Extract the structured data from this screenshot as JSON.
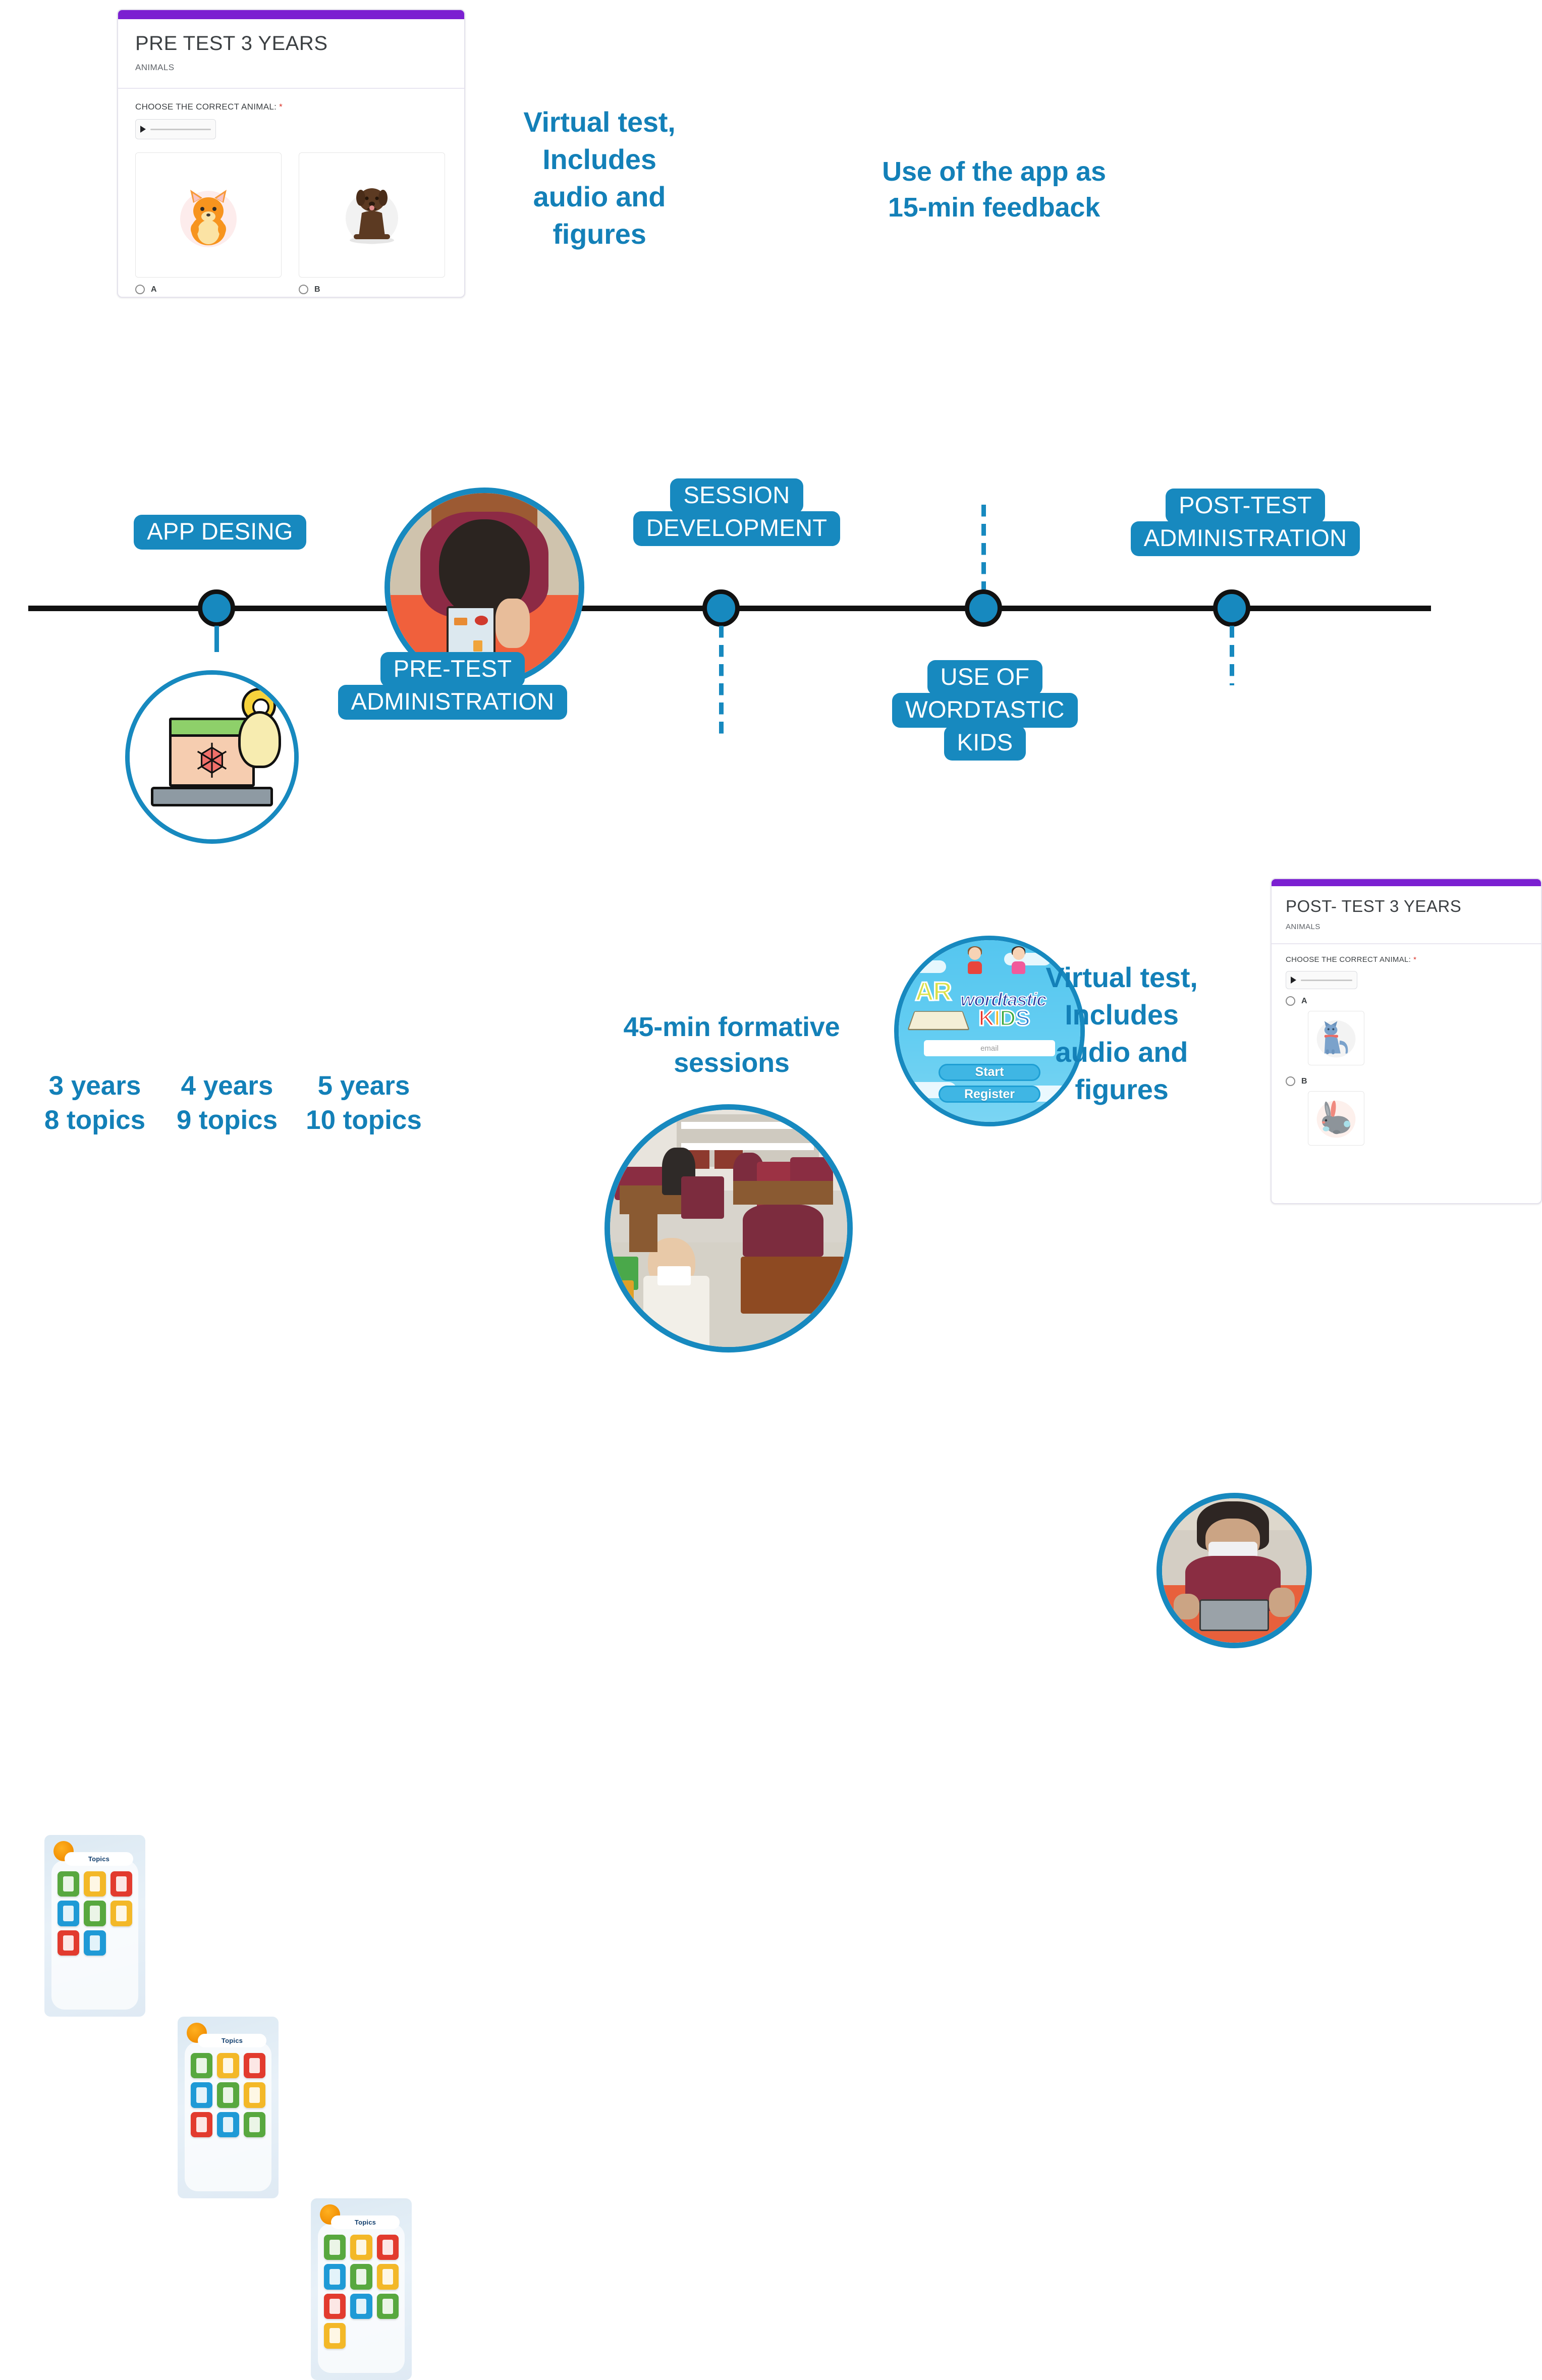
{
  "timeline": {
    "milestones": [
      {
        "id": "app-desing",
        "label_lines": [
          "APP DESING"
        ]
      },
      {
        "id": "pre-test-administration",
        "label_lines": [
          "PRE-TEST",
          "ADMINISTRATION"
        ]
      },
      {
        "id": "session-development",
        "label_lines": [
          "SESSION",
          "DEVELOPMENT"
        ]
      },
      {
        "id": "use-of-wordtastic-kids",
        "label_lines": [
          "USE OF",
          "WORDTASTIC",
          "KIDS"
        ]
      },
      {
        "id": "post-test-administration",
        "label_lines": [
          "POST-TEST",
          "ADMINISTRATION"
        ]
      }
    ],
    "accent_color": "#1789bf",
    "axis_color": "#111111"
  },
  "annotations": {
    "pre_test_note": [
      "Virtual test,",
      "Includes",
      "audio and",
      "figures"
    ],
    "app_feedback_note": [
      "Use of the app as",
      "15-min feedback"
    ],
    "sessions_note": [
      "45-min formative",
      "sessions"
    ],
    "post_test_note": [
      "Virtual test,",
      "Includes",
      "audio and",
      "figures"
    ],
    "text_color": "#1380b8"
  },
  "pre_test_form": {
    "accent_color": "#7b1fd1",
    "title": "PRE TEST 3 YEARS",
    "section": "ANIMALS",
    "question": "CHOOSE THE CORRECT ANIMAL:",
    "required_mark": "*",
    "options": [
      {
        "letter": "A",
        "image": "hamster-illustration"
      },
      {
        "letter": "B",
        "image": "dog-illustration"
      }
    ]
  },
  "post_test_form": {
    "accent_color": "#7b1fd1",
    "title": "POST- TEST 3 YEARS",
    "section": "ANIMALS",
    "question": "CHOOSE THE CORRECT ANIMAL:",
    "required_mark": "*",
    "options": [
      {
        "letter": "A",
        "image": "cat-illustration"
      },
      {
        "letter": "B",
        "image": "rabbit-illustration"
      }
    ]
  },
  "app_splash": {
    "logo_ar": "AR",
    "logo_wordtastic": "wordtastic",
    "logo_kids_letters": [
      {
        "ch": "K",
        "color": "#e8342a"
      },
      {
        "ch": "I",
        "color": "#f6b41a"
      },
      {
        "ch": "D",
        "color": "#3aa63a"
      },
      {
        "ch": "S",
        "color": "#2f7fd0"
      }
    ],
    "email_placeholder": "email",
    "start_button": "Start",
    "register_button": "Register"
  },
  "age_variants": [
    {
      "age": "3 years",
      "topics": "8 topics",
      "topics_header": "Topics",
      "tile_count": 8,
      "tile_colors": [
        "#58a83f",
        "#f3b828",
        "#e23b2e",
        "#1f9ad6",
        "#58a83f",
        "#f3b828",
        "#e23b2e",
        "#1f9ad6"
      ]
    },
    {
      "age": "4 years",
      "topics": "9 topics",
      "topics_header": "Topics",
      "tile_count": 9,
      "tile_colors": [
        "#58a83f",
        "#f3b828",
        "#e23b2e",
        "#1f9ad6",
        "#58a83f",
        "#f3b828",
        "#e23b2e",
        "#1f9ad6",
        "#58a83f"
      ]
    },
    {
      "age": "5 years",
      "topics": "10 topics",
      "topics_header": "Topics",
      "tile_count": 10,
      "tile_colors": [
        "#58a83f",
        "#f3b828",
        "#e23b2e",
        "#1f9ad6",
        "#58a83f",
        "#f3b828",
        "#e23b2e",
        "#1f9ad6",
        "#58a83f",
        "#f3b828"
      ]
    }
  ],
  "photos": [
    {
      "id": "child-tablet-top-view",
      "caption_ref": "pre_test_note"
    },
    {
      "id": "classroom-session",
      "caption_ref": "sessions_note"
    },
    {
      "id": "child-tablet-post-test",
      "caption_ref": "post_test_note"
    }
  ]
}
